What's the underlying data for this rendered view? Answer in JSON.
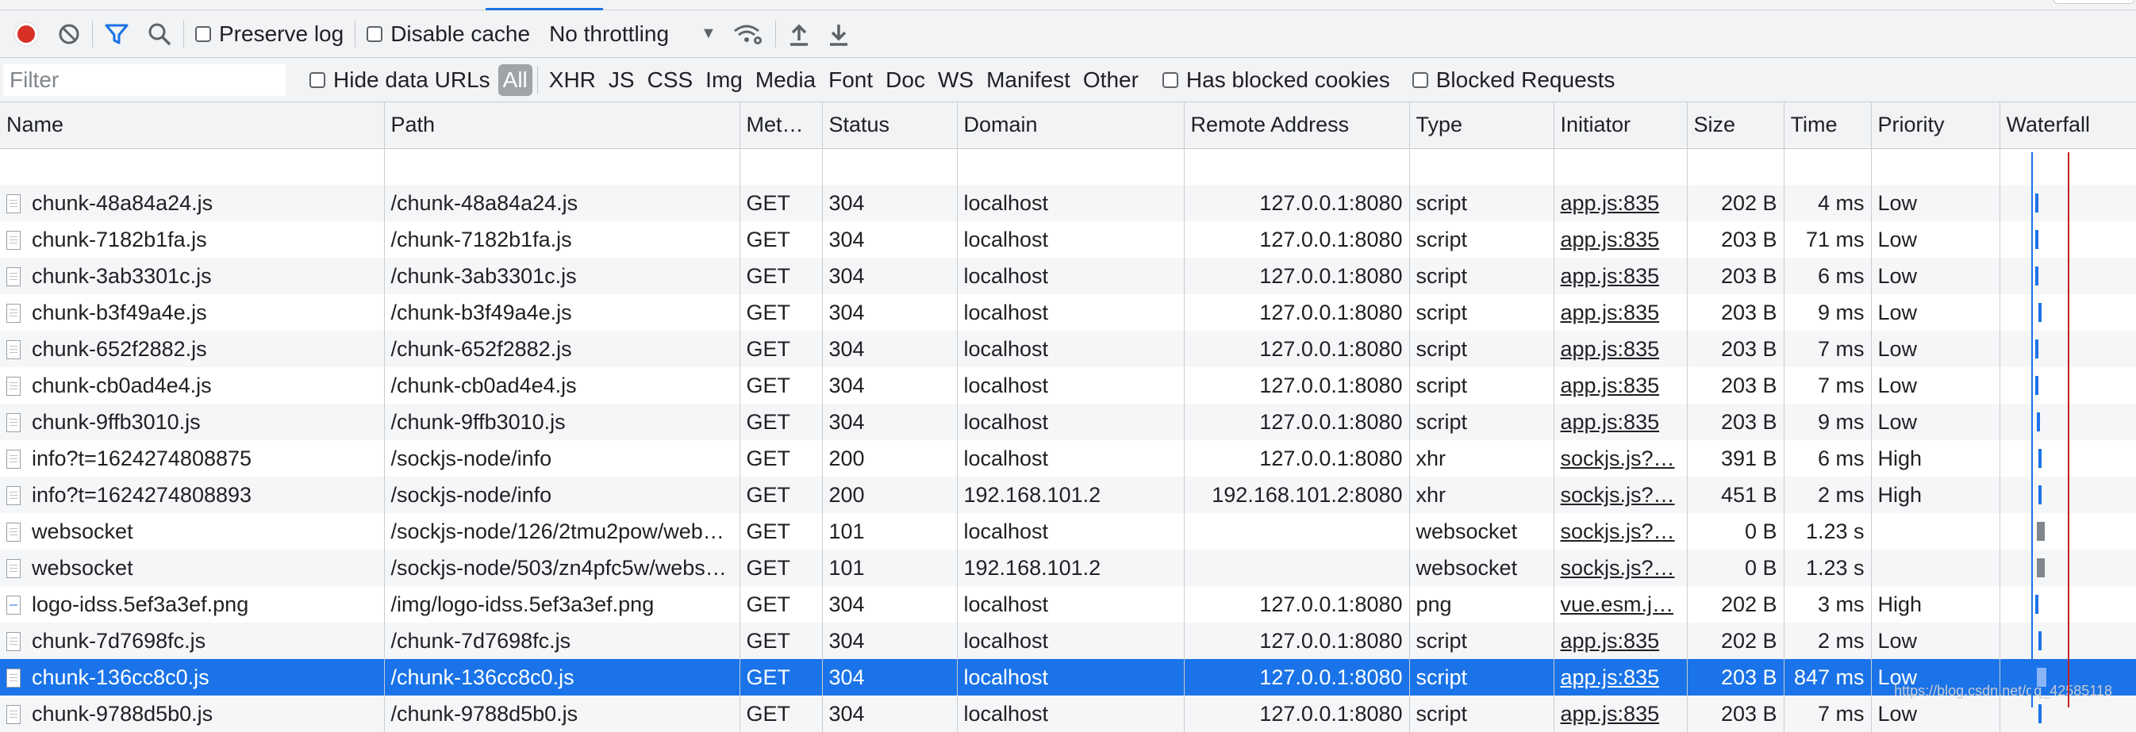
{
  "toolbar": {
    "preserve_log": "Preserve log",
    "disable_cache": "Disable cache",
    "throttling": "No throttling"
  },
  "filterbar": {
    "filter_placeholder": "Filter",
    "hide_data_urls": "Hide data URLs",
    "types": [
      "All",
      "XHR",
      "JS",
      "CSS",
      "Img",
      "Media",
      "Font",
      "Doc",
      "WS",
      "Manifest",
      "Other"
    ],
    "has_blocked_cookies": "Has blocked cookies",
    "blocked_requests": "Blocked Requests"
  },
  "columns": [
    "Name",
    "Path",
    "Met…",
    "Status",
    "Domain",
    "Remote Address",
    "Type",
    "Initiator",
    "Size",
    "Time",
    "Priority",
    "Waterfall"
  ],
  "rows": [
    {
      "name": "chunk-48a84a24.js",
      "path": "/chunk-48a84a24.js",
      "method": "GET",
      "status": "304",
      "domain": "localhost",
      "remote": "127.0.0.1:8080",
      "type": "script",
      "initiator": "app.js:835",
      "size": "202 B",
      "time": "4 ms",
      "priority": "Low"
    },
    {
      "name": "chunk-7182b1fa.js",
      "path": "/chunk-7182b1fa.js",
      "method": "GET",
      "status": "304",
      "domain": "localhost",
      "remote": "127.0.0.1:8080",
      "type": "script",
      "initiator": "app.js:835",
      "size": "203 B",
      "time": "71 ms",
      "priority": "Low"
    },
    {
      "name": "chunk-3ab3301c.js",
      "path": "/chunk-3ab3301c.js",
      "method": "GET",
      "status": "304",
      "domain": "localhost",
      "remote": "127.0.0.1:8080",
      "type": "script",
      "initiator": "app.js:835",
      "size": "203 B",
      "time": "6 ms",
      "priority": "Low"
    },
    {
      "name": "chunk-b3f49a4e.js",
      "path": "/chunk-b3f49a4e.js",
      "method": "GET",
      "status": "304",
      "domain": "localhost",
      "remote": "127.0.0.1:8080",
      "type": "script",
      "initiator": "app.js:835",
      "size": "203 B",
      "time": "9 ms",
      "priority": "Low"
    },
    {
      "name": "chunk-652f2882.js",
      "path": "/chunk-652f2882.js",
      "method": "GET",
      "status": "304",
      "domain": "localhost",
      "remote": "127.0.0.1:8080",
      "type": "script",
      "initiator": "app.js:835",
      "size": "203 B",
      "time": "7 ms",
      "priority": "Low"
    },
    {
      "name": "chunk-cb0ad4e4.js",
      "path": "/chunk-cb0ad4e4.js",
      "method": "GET",
      "status": "304",
      "domain": "localhost",
      "remote": "127.0.0.1:8080",
      "type": "script",
      "initiator": "app.js:835",
      "size": "203 B",
      "time": "7 ms",
      "priority": "Low"
    },
    {
      "name": "chunk-9ffb3010.js",
      "path": "/chunk-9ffb3010.js",
      "method": "GET",
      "status": "304",
      "domain": "localhost",
      "remote": "127.0.0.1:8080",
      "type": "script",
      "initiator": "app.js:835",
      "size": "203 B",
      "time": "9 ms",
      "priority": "Low"
    },
    {
      "name": "info?t=1624274808875",
      "path": "/sockjs-node/info",
      "method": "GET",
      "status": "200",
      "domain": "localhost",
      "remote": "127.0.0.1:8080",
      "type": "xhr",
      "initiator": "sockjs.js?…",
      "size": "391 B",
      "time": "6 ms",
      "priority": "High"
    },
    {
      "name": "info?t=1624274808893",
      "path": "/sockjs-node/info",
      "method": "GET",
      "status": "200",
      "domain": "192.168.101.2",
      "remote": "192.168.101.2:8080",
      "type": "xhr",
      "initiator": "sockjs.js?…",
      "size": "451 B",
      "time": "2 ms",
      "priority": "High"
    },
    {
      "name": "websocket",
      "path": "/sockjs-node/126/2tmu2pow/web…",
      "method": "GET",
      "status": "101",
      "domain": "localhost",
      "remote": "",
      "type": "websocket",
      "initiator": "sockjs.js?…",
      "size": "0 B",
      "time": "1.23 s",
      "priority": ""
    },
    {
      "name": "websocket",
      "path": "/sockjs-node/503/zn4pfc5w/webs…",
      "method": "GET",
      "status": "101",
      "domain": "192.168.101.2",
      "remote": "",
      "type": "websocket",
      "initiator": "sockjs.js?…",
      "size": "0 B",
      "time": "1.23 s",
      "priority": ""
    },
    {
      "name": "logo-idss.5ef3a3ef.png",
      "path": "/img/logo-idss.5ef3a3ef.png",
      "method": "GET",
      "status": "304",
      "domain": "localhost",
      "remote": "127.0.0.1:8080",
      "type": "png",
      "initiator": "vue.esm.j…",
      "size": "202 B",
      "time": "3 ms",
      "priority": "High"
    },
    {
      "name": "chunk-7d7698fc.js",
      "path": "/chunk-7d7698fc.js",
      "method": "GET",
      "status": "304",
      "domain": "localhost",
      "remote": "127.0.0.1:8080",
      "type": "script",
      "initiator": "app.js:835",
      "size": "202 B",
      "time": "2 ms",
      "priority": "Low"
    },
    {
      "name": "chunk-136cc8c0.js",
      "path": "/chunk-136cc8c0.js",
      "method": "GET",
      "status": "304",
      "domain": "localhost",
      "remote": "127.0.0.1:8080",
      "type": "script",
      "initiator": "app.js:835",
      "size": "203 B",
      "time": "847 ms",
      "priority": "Low"
    },
    {
      "name": "chunk-9788d5b0.js",
      "path": "/chunk-9788d5b0.js",
      "method": "GET",
      "status": "304",
      "domain": "localhost",
      "remote": "127.0.0.1:8080",
      "type": "script",
      "initiator": "app.js:835",
      "size": "203 B",
      "time": "7 ms",
      "priority": "Low"
    }
  ],
  "selected_row": 13,
  "watermark": "https://blog.csdn.net/qq_42585118",
  "colors": {
    "accent": "#1a73e8",
    "record": "#d93025",
    "selected": "#1a73e8"
  }
}
